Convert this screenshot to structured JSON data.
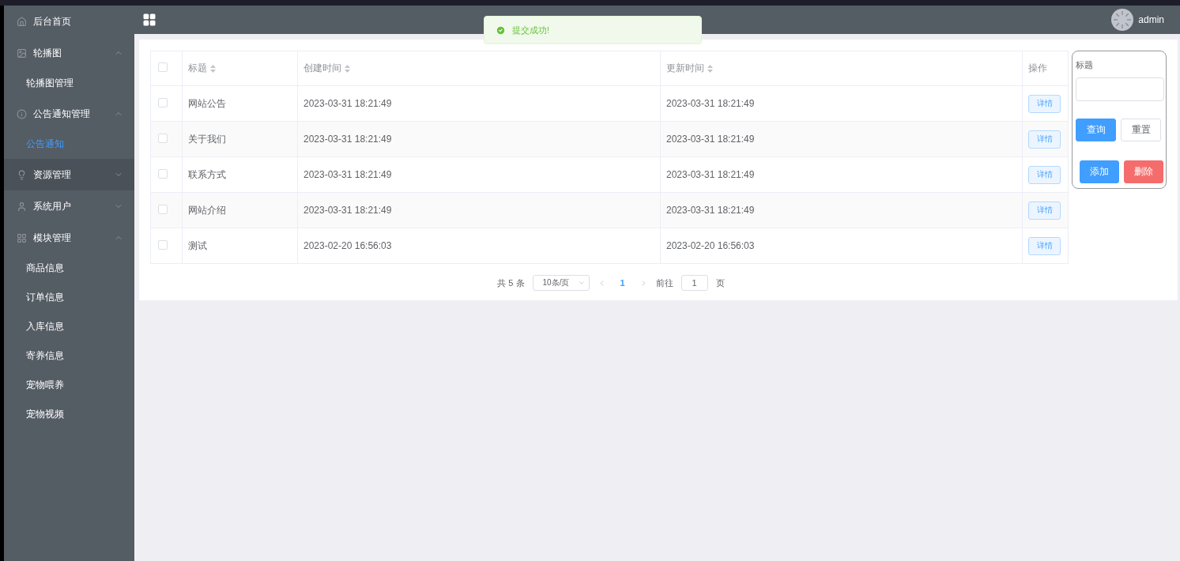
{
  "sidebar": {
    "items": [
      {
        "label": "后台首页",
        "hovered": false
      },
      {
        "label": "轮播图",
        "hovered": false,
        "expanded": true,
        "children": [
          {
            "label": "轮播图管理",
            "selected": false
          }
        ]
      },
      {
        "label": "公告通知管理",
        "hovered": false,
        "expanded": true,
        "children": [
          {
            "label": "公告通知",
            "selected": true
          }
        ]
      },
      {
        "label": "资源管理",
        "hovered": true,
        "expanded": false
      },
      {
        "label": "系统用户",
        "hovered": false,
        "expanded": false
      },
      {
        "label": "模块管理",
        "hovered": false,
        "expanded": true,
        "children": [
          {
            "label": "商品信息",
            "selected": false
          },
          {
            "label": "订单信息",
            "selected": false
          },
          {
            "label": "入库信息",
            "selected": false
          },
          {
            "label": "寄养信息",
            "selected": false
          },
          {
            "label": "宠物喂养",
            "selected": false
          },
          {
            "label": "宠物视频",
            "selected": false
          }
        ]
      }
    ]
  },
  "header": {
    "user": "admin"
  },
  "toast": {
    "message": "提交成功!"
  },
  "table": {
    "all_checked": false,
    "columns": [
      {
        "label": "标题",
        "sortable": true
      },
      {
        "label": "创建时间",
        "sortable": true
      },
      {
        "label": "更新时间",
        "sortable": true
      },
      {
        "label": "操作",
        "sortable": false
      }
    ],
    "rows": [
      {
        "checked": false,
        "title": "网站公告",
        "created": "2023-03-31 18:21:49",
        "updated": "2023-03-31 18:21:49",
        "action": "详情"
      },
      {
        "checked": false,
        "title": "关于我们",
        "created": "2023-03-31 18:21:49",
        "updated": "2023-03-31 18:21:49",
        "action": "详情"
      },
      {
        "checked": false,
        "title": "联系方式",
        "created": "2023-03-31 18:21:49",
        "updated": "2023-03-31 18:21:49",
        "action": "详情"
      },
      {
        "checked": false,
        "title": "网站介绍",
        "created": "2023-03-31 18:21:49",
        "updated": "2023-03-31 18:21:49",
        "action": "详情"
      },
      {
        "checked": false,
        "title": "测试",
        "created": "2023-02-20 16:56:03",
        "updated": "2023-02-20 16:56:03",
        "action": "详情"
      }
    ]
  },
  "pagination": {
    "total": "共 5 条",
    "page_size": "10条/页",
    "pages": [
      {
        "label": "1",
        "selected": true
      }
    ],
    "goto_label": "前往",
    "goto_value": "1",
    "goto_suffix": "页"
  },
  "filter": {
    "label": "标题",
    "buttons": [
      {
        "label": "查询",
        "kind": "primary"
      },
      {
        "label": "重置",
        "kind": "default"
      },
      {
        "label": "添加",
        "kind": "primary"
      },
      {
        "label": "删除",
        "kind": "danger"
      }
    ]
  }
}
